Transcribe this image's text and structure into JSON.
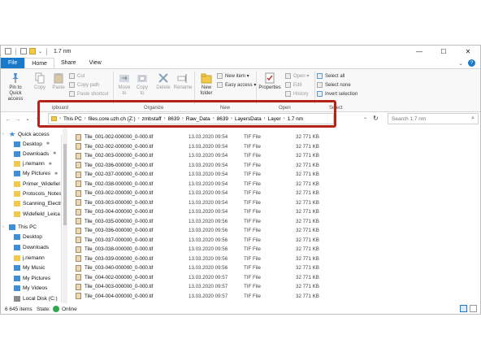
{
  "window": {
    "title": "1.7 nm",
    "controls": {
      "minimize": "—",
      "maximize": "☐",
      "close": "✕"
    }
  },
  "ribbon_tabs": {
    "file": "File",
    "home": "Home",
    "share": "Share",
    "view": "View",
    "expand": "⌄",
    "help": "?"
  },
  "ribbon": {
    "pin": "Pin to Quick access",
    "copy": "Copy",
    "paste": "Paste",
    "cut": "Cut",
    "copy_path": "Copy path",
    "paste_shortcut": "Paste shortcut",
    "move_to": "Move to",
    "copy_to": "Copy to",
    "delete": "Delete",
    "rename": "Rename",
    "new_folder": "New folder",
    "new_item": "New item ▾",
    "easy_access": "Easy access ▾",
    "properties": "Properties",
    "open": "Open ▾",
    "edit": "Edit",
    "history": "History",
    "select_all": "Select all",
    "select_none": "Select none",
    "invert_selection": "Invert selection",
    "groups": {
      "clipboard": "ipboard",
      "organize": "Organize",
      "new": "New",
      "open": "Open",
      "select": "Select"
    }
  },
  "address": {
    "parts": [
      "This PC",
      "files.core.uzh.ch (Z:)",
      "zmbstaff",
      "8639",
      "Raw_Data",
      "8639",
      "LayersData",
      "Layer",
      "1.7 nm"
    ],
    "separator": "›",
    "dropdown": "⌄",
    "refresh": "↻"
  },
  "nav_buttons": {
    "back": "←",
    "forward": "→",
    "recent": "⌄",
    "up": "↑"
  },
  "search": {
    "placeholder": "Search 1.7 nm",
    "icon": "⌕"
  },
  "nav": {
    "quick_access": "Quick access",
    "items": [
      {
        "label": "Desktop",
        "icon": "desktop-icon",
        "pinned": true
      },
      {
        "label": "Downloads",
        "icon": "downloads-icon",
        "pinned": true
      },
      {
        "label": "j.riemann",
        "icon": "user-folder-icon",
        "pinned": true
      },
      {
        "label": "My Pictures",
        "icon": "pictures-icon",
        "pinned": true
      },
      {
        "label": "Primer_Widefiel",
        "icon": "folder-icon",
        "pinned": false
      },
      {
        "label": "Protocols_Notes",
        "icon": "folder-icon",
        "pinned": false
      },
      {
        "label": "Scanning_Electr",
        "icon": "folder-icon",
        "pinned": false
      },
      {
        "label": "Widefield_Leica",
        "icon": "folder-icon",
        "pinned": false
      }
    ],
    "this_pc": "This PC",
    "pc_items": [
      {
        "label": "Desktop",
        "icon": "desktop-icon"
      },
      {
        "label": "Downloads",
        "icon": "downloads-icon"
      },
      {
        "label": "j.riemann",
        "icon": "user-folder-icon"
      },
      {
        "label": "My Music",
        "icon": "music-icon"
      },
      {
        "label": "My Pictures",
        "icon": "pictures-icon"
      },
      {
        "label": "My Videos",
        "icon": "videos-icon"
      },
      {
        "label": "Local Disk (C:)",
        "icon": "disk-icon"
      }
    ],
    "pin_glyph": "✱",
    "expand_glyph": "›"
  },
  "sort_caret": "^",
  "files": [
    {
      "name": "Tile_001-002-000000_0-000.tif",
      "date": "13.03.2020 09:54",
      "type": "TIF File",
      "size": "32 771 KB"
    },
    {
      "name": "Tile_002-002-000000_0-000.tif",
      "date": "13.03.2020 09:54",
      "type": "TIF File",
      "size": "32 771 KB"
    },
    {
      "name": "Tile_002-003-000000_0-000.tif",
      "date": "13.03.2020 09:54",
      "type": "TIF File",
      "size": "32 771 KB"
    },
    {
      "name": "Tile_002-036-000000_0-000.tif",
      "date": "13.03.2020 09:54",
      "type": "TIF File",
      "size": "32 771 KB"
    },
    {
      "name": "Tile_002-037-000000_0-000.tif",
      "date": "13.03.2020 09:54",
      "type": "TIF File",
      "size": "32 771 KB"
    },
    {
      "name": "Tile_002-038-000000_0-000.tif",
      "date": "13.03.2020 09:54",
      "type": "TIF File",
      "size": "32 771 KB"
    },
    {
      "name": "Tile_003-002-000000_0-000.tif",
      "date": "13.03.2020 09:54",
      "type": "TIF File",
      "size": "32 771 KB"
    },
    {
      "name": "Tile_003-003-000000_0-000.tif",
      "date": "13.03.2020 09:54",
      "type": "TIF File",
      "size": "32 771 KB"
    },
    {
      "name": "Tile_003-004-000000_0-000.tif",
      "date": "13.03.2020 09:54",
      "type": "TIF File",
      "size": "32 771 KB"
    },
    {
      "name": "Tile_003-035-000000_0-000.tif",
      "date": "13.03.2020 09:56",
      "type": "TIF File",
      "size": "32 771 KB"
    },
    {
      "name": "Tile_003-036-000000_0-000.tif",
      "date": "13.03.2020 09:56",
      "type": "TIF File",
      "size": "32 771 KB"
    },
    {
      "name": "Tile_003-037-000000_0-000.tif",
      "date": "13.03.2020 09:56",
      "type": "TIF File",
      "size": "32 771 KB"
    },
    {
      "name": "Tile_003-038-000000_0-000.tif",
      "date": "13.03.2020 09:56",
      "type": "TIF File",
      "size": "32 771 KB"
    },
    {
      "name": "Tile_003-039-000000_0-000.tif",
      "date": "13.03.2020 09:56",
      "type": "TIF File",
      "size": "32 771 KB"
    },
    {
      "name": "Tile_003-040-000000_0-000.tif",
      "date": "13.03.2020 09:56",
      "type": "TIF File",
      "size": "32 771 KB"
    },
    {
      "name": "Tile_004-002-000000_0-000.tif",
      "date": "13.03.2020 09:57",
      "type": "TIF File",
      "size": "32 771 KB"
    },
    {
      "name": "Tile_004-003-000000_0-000.tif",
      "date": "13.03.2020 09:57",
      "type": "TIF File",
      "size": "32 771 KB"
    },
    {
      "name": "Tile_004-004-000000_0-000.tif",
      "date": "13.03.2020 09:57",
      "type": "TIF File",
      "size": "32 771 KB"
    }
  ],
  "status": {
    "count": "6 645 items",
    "state_label": "State:",
    "state_value": "Online"
  },
  "colors": {
    "accent": "#1979ca",
    "highlight": "#b52416",
    "online": "#2fa84f"
  }
}
